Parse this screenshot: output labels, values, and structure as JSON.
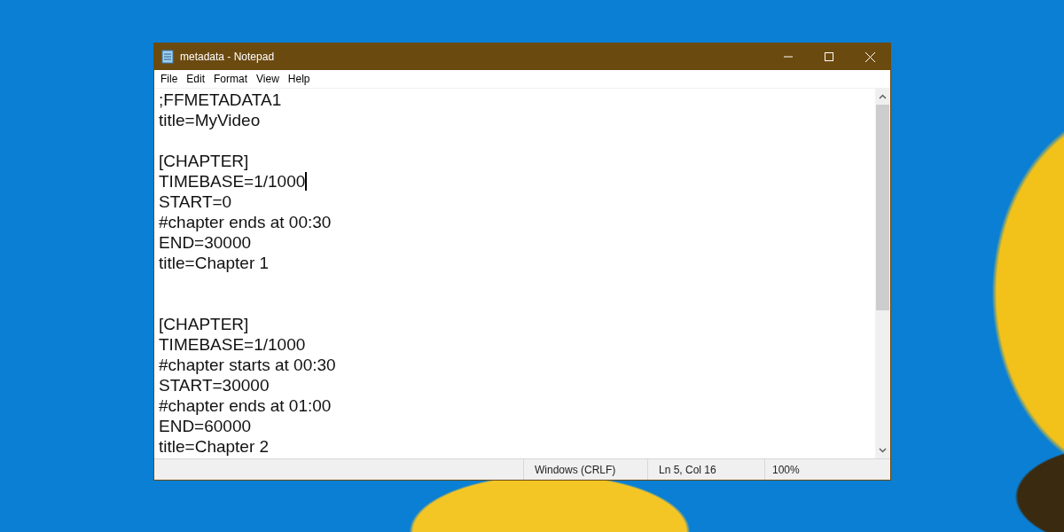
{
  "window": {
    "title": "metadata - Notepad"
  },
  "menu": [
    "File",
    "Edit",
    "Format",
    "View",
    "Help"
  ],
  "lines": [
    {
      "kind": "text",
      "text": ";FFMETADATA1",
      "caret": false
    },
    {
      "kind": "text",
      "text": "title=MyVideo",
      "caret": false
    },
    {
      "kind": "blank"
    },
    {
      "kind": "text",
      "text": "[CHAPTER]",
      "caret": false
    },
    {
      "kind": "text",
      "text": "TIMEBASE=1/1000",
      "caret": true
    },
    {
      "kind": "text",
      "text": "START=0",
      "caret": false
    },
    {
      "kind": "text",
      "text": "#chapter ends at 00:30",
      "caret": false
    },
    {
      "kind": "text",
      "text": "END=30000",
      "caret": false
    },
    {
      "kind": "text",
      "text": "title=Chapter 1",
      "caret": false
    },
    {
      "kind": "blank"
    },
    {
      "kind": "blank"
    },
    {
      "kind": "text",
      "text": "[CHAPTER]",
      "caret": false
    },
    {
      "kind": "text",
      "text": "TIMEBASE=1/1000",
      "caret": false
    },
    {
      "kind": "text",
      "text": "#chapter starts at 00:30",
      "caret": false
    },
    {
      "kind": "text",
      "text": "START=30000",
      "caret": false
    },
    {
      "kind": "text",
      "text": "#chapter ends at 01:00",
      "caret": false
    },
    {
      "kind": "text",
      "text": "END=60000",
      "caret": false
    },
    {
      "kind": "text",
      "text": "title=Chapter 2",
      "caret": false
    }
  ],
  "status_bar": {
    "line_ending": "Windows (CRLF)",
    "position": "Ln 5, Col 16",
    "zoom": "100%"
  }
}
